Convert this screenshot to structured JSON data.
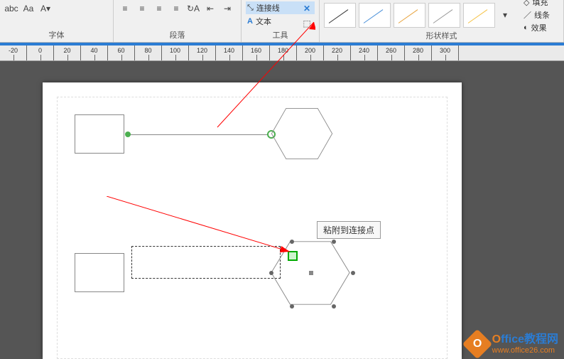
{
  "ribbon": {
    "font_label": "字体",
    "para_label": "段落",
    "tool_label": "工具",
    "style_label": "形状样式",
    "connector_btn": "连接线",
    "text_btn": "文本",
    "fill_btn": "填充",
    "line_btn": "线条",
    "effect_btn": "效果"
  },
  "ruler": {
    "marks": [
      "-20",
      "0",
      "20",
      "40",
      "60",
      "80",
      "100",
      "120",
      "140",
      "160",
      "180",
      "200",
      "220",
      "240",
      "260",
      "280",
      "300"
    ]
  },
  "tooltip": "粘附到连接点",
  "watermark": {
    "badge": "O",
    "title_o": "O",
    "title_rest": "ffice教程网",
    "url": "www.office26.com"
  }
}
